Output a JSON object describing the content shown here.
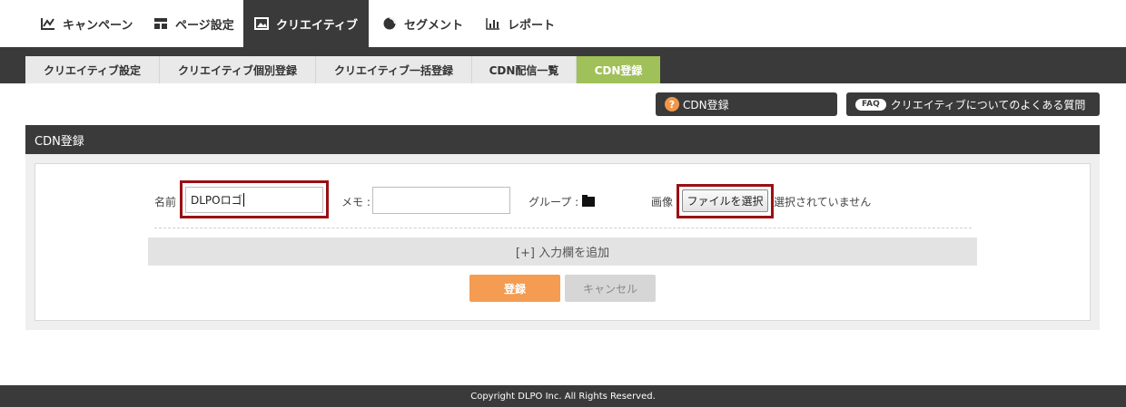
{
  "top_nav": {
    "tabs": [
      {
        "label": "キャンペーン",
        "icon": "campaign-icon"
      },
      {
        "label": "ページ設定",
        "icon": "page-layout-icon"
      },
      {
        "label": "クリエイティブ",
        "icon": "image-icon",
        "active": true
      },
      {
        "label": "セグメント",
        "icon": "pie-chart-icon"
      },
      {
        "label": "レポート",
        "icon": "bar-chart-icon"
      }
    ]
  },
  "sub_nav": {
    "tabs": [
      {
        "label": "クリエイティブ設定"
      },
      {
        "label": "クリエイティブ個別登録"
      },
      {
        "label": "クリエイティブ一括登録"
      },
      {
        "label": "CDN配信一覧"
      },
      {
        "label": "CDN登録",
        "active": true
      }
    ]
  },
  "help": {
    "cdn_help_label": "CDN登録",
    "faq_badge": "FAQ",
    "faq_label": "クリエイティブについてのよくある質問"
  },
  "panel": {
    "title": "CDN登録"
  },
  "form": {
    "name_label": "名前",
    "name_value": "DLPOロゴ",
    "memo_label": "メモ :",
    "memo_value": "",
    "group_label": "グループ :",
    "image_label": "画像",
    "file_button_label": "ファイルを選択",
    "file_status": "選択されていません",
    "add_row_label": "[+] 入力欄を追加",
    "submit_label": "登録",
    "cancel_label": "キャンセル"
  },
  "colors": {
    "dark_bar": "#3a3a3a",
    "active_subtab": "#a0c05a",
    "primary_button": "#f49c52",
    "highlight_box": "#9a0f14"
  },
  "footer": {
    "copyright": "Copyright DLPO Inc. All Rights Reserved."
  }
}
